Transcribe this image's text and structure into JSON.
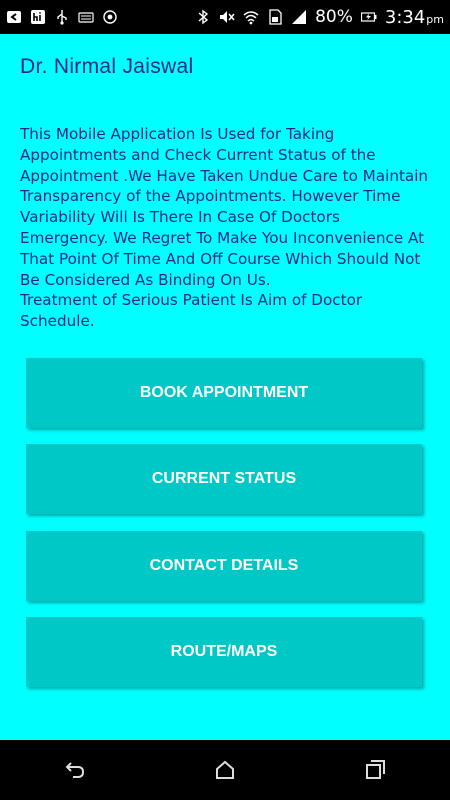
{
  "status_bar": {
    "battery_percent": "80%",
    "time": "3:34",
    "ampm": "pm",
    "icons_left": [
      "back-box-icon",
      "hi-icon",
      "usb-icon",
      "keyboard-icon",
      "record-icon"
    ],
    "icons_right": [
      "bluetooth-icon",
      "mute-icon",
      "wifi-icon",
      "sim-icon",
      "signal-icon",
      "battery-charging-icon"
    ]
  },
  "app_bar": {
    "title": "Dr. Nirmal Jaiswal"
  },
  "main": {
    "description": "This Mobile Application Is Used for Taking Appointments and Check Current Status of the Appointment .We Have Taken Undue Care to Maintain Transparency of the Appointments. However Time Variability Will Is There In Case Of Doctors Emergency. We Regret To Make You Inconvenience At That Point Of Time And Off Course Which Should Not Be Considered As Binding On Us.\nTreatment of Serious Patient Is Aim of Doctor Schedule.",
    "buttons": [
      {
        "label": "BOOK APPOINTMENT"
      },
      {
        "label": "CURRENT STATUS"
      },
      {
        "label": "CONTACT DETAILS"
      },
      {
        "label": "ROUTE/MAPS"
      }
    ]
  },
  "nav_bar": {
    "icons": [
      "back-icon",
      "home-icon",
      "recents-icon"
    ]
  },
  "colors": {
    "background": "#00ffff",
    "button": "#00c8c6",
    "text": "#1a2a8a"
  }
}
